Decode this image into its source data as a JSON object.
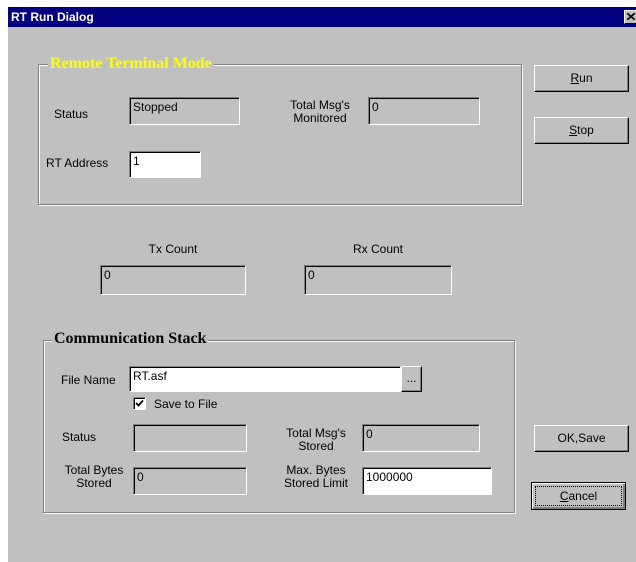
{
  "window": {
    "title": "RT Run Dialog",
    "close_glyph": "×"
  },
  "rt_group": {
    "legend": "Remote Terminal Mode",
    "status_label": "Status",
    "status_value": "Stopped",
    "total_msgs_label_line1": "Total Msg's",
    "total_msgs_label_line2": "Monitored",
    "total_msgs_value": "0",
    "rt_address_label": "RT Address",
    "rt_address_value": "1"
  },
  "counts": {
    "tx_label": "Tx Count",
    "tx_value": "0",
    "rx_label": "Rx Count",
    "rx_value": "0"
  },
  "comm_group": {
    "legend": "Communication Stack",
    "file_name_label": "File Name",
    "file_name_value": "RT.asf",
    "browse_label": "...",
    "save_to_file_label": "Save to File",
    "save_to_file_checked": true,
    "status_label": "Status",
    "status_value": "",
    "total_msgs_stored_label_line1": "Total Msg's",
    "total_msgs_stored_label_line2": "Stored",
    "total_msgs_stored_value": "0",
    "total_bytes_label_line1": "Total Bytes",
    "total_bytes_label_line2": "Stored",
    "total_bytes_value": "0",
    "max_bytes_label_line1": "Max. Bytes",
    "max_bytes_label_line2": "Stored Limit",
    "max_bytes_value": "1000000"
  },
  "buttons": {
    "run": {
      "pre": "",
      "accel": "R",
      "post": "un"
    },
    "stop": {
      "pre": "",
      "accel": "S",
      "post": "top"
    },
    "ok_save": {
      "pre": "OK,Save",
      "accel": "",
      "post": ""
    },
    "cancel": {
      "pre": "",
      "accel": "C",
      "post": "ancel"
    }
  },
  "colors": {
    "title_bar": "#000080",
    "face": "#c0c0c0",
    "legend_rt": "#ffff00"
  },
  "icons": {
    "close": "close-icon",
    "check": "checkmark-icon"
  }
}
